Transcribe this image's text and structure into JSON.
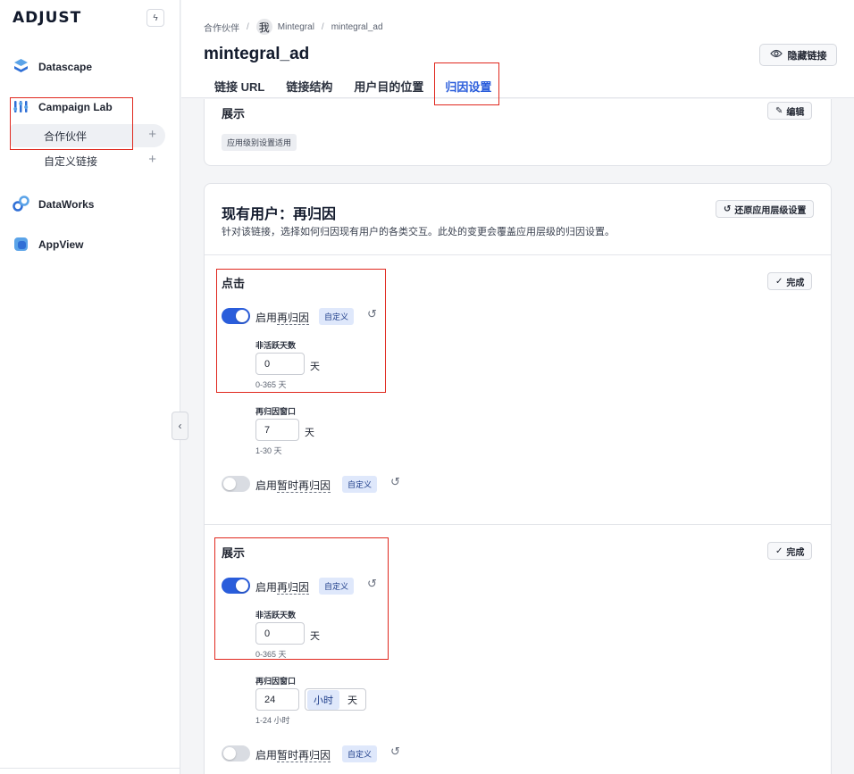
{
  "brand": {
    "logo": "ADJUST"
  },
  "sidebar": {
    "groups": [
      {
        "label": "Datascape",
        "icon": "datascape-icon"
      },
      {
        "label": "Campaign Lab",
        "icon": "campaign-lab-icon",
        "items": [
          {
            "label": "合作伙伴",
            "plus": "+"
          },
          {
            "label": "自定义链接",
            "plus": "+"
          }
        ]
      },
      {
        "label": "DataWorks",
        "icon": "dataworks-icon"
      },
      {
        "label": "AppView",
        "icon": "appview-icon"
      }
    ],
    "collapse_glyph": "‹"
  },
  "header": {
    "breadcrumb": [
      "合作伙伴",
      "Mintegral",
      "mintegral_ad"
    ],
    "avatar_char": "我",
    "title": "mintegral_ad",
    "hide_button": "隐藏链接",
    "tabs": [
      "链接 URL",
      "链接结构",
      "用户目的位置",
      "归因设置"
    ],
    "active_tab": "归因设置"
  },
  "card_top": {
    "heading": "展示",
    "edit_button": "编辑",
    "tag": "应用级别设置适用"
  },
  "reattribution": {
    "title": "现有用户：再归因",
    "description": "针对该链接，选择如何归因现有用户的各类交互。此处的变更会覆盖应用层级的归因设置。",
    "restore_button": "还原应用层级设置",
    "click": {
      "heading": "点击",
      "done_button": "完成",
      "enable_prefix": "启用",
      "enable_dashed": "再归因",
      "enable_on": true,
      "custom_tag": "自定义",
      "inactive_label": "非活跃天数",
      "inactive_value": "0",
      "inactive_unit": "天",
      "inactive_hint": "0-365 天",
      "window_label": "再归因窗口",
      "window_value": "7",
      "window_unit": "天",
      "window_hint": "1-30 天",
      "temp_prefix": "启用",
      "temp_dashed": "暂时再归因",
      "temp_on": false,
      "temp_tag": "自定义"
    },
    "impression": {
      "heading": "展示",
      "done_button": "完成",
      "enable_prefix": "启用",
      "enable_dashed": "再归因",
      "enable_on": true,
      "custom_tag": "自定义",
      "inactive_label": "非活跃天数",
      "inactive_value": "0",
      "inactive_unit": "天",
      "inactive_hint": "0-365 天",
      "window_label": "再归因窗口",
      "window_value": "24",
      "window_unit_options": [
        "小时",
        "天"
      ],
      "window_unit_selected": "小时",
      "window_hint": "1-24 小时",
      "temp_prefix": "启用",
      "temp_dashed": "暂时再归因",
      "temp_on": false,
      "temp_tag": "自定义"
    }
  },
  "colors": {
    "accent": "#2a5ddb",
    "highlight_box": "#e0281e",
    "tag_blue_bg": "#dfe8fb"
  }
}
